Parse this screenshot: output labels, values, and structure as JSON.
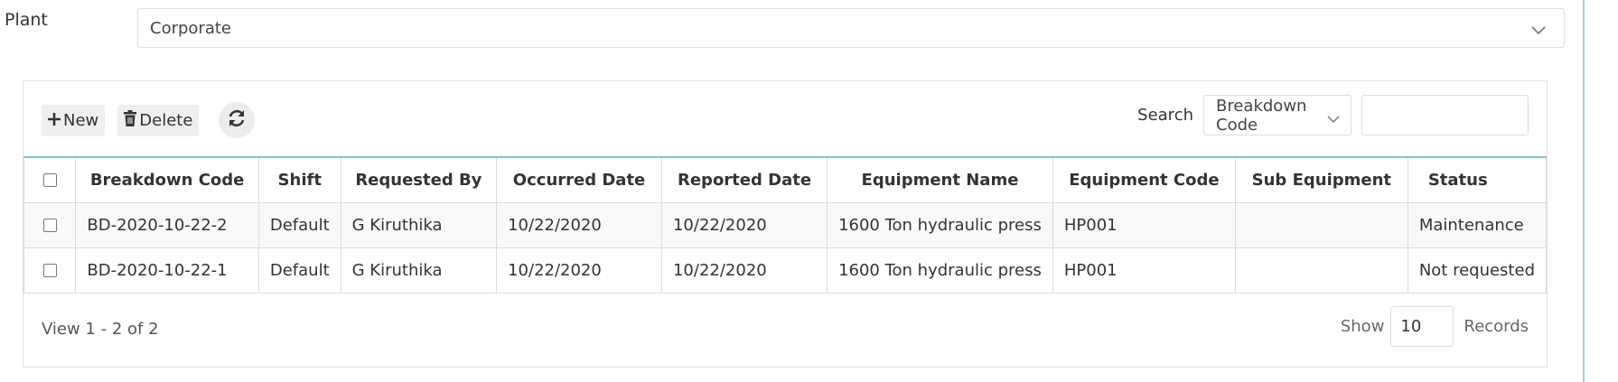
{
  "filter": {
    "plant_label": "Plant",
    "plant_value": "Corporate"
  },
  "toolbar": {
    "new_label": "New",
    "delete_label": "Delete",
    "search_label": "Search",
    "search_field": "Breakdown Code",
    "search_value": ""
  },
  "table": {
    "columns": [
      "Breakdown Code",
      "Shift",
      "Requested By",
      "Occurred Date",
      "Reported Date",
      "Equipment Name",
      "Equipment Code",
      "Sub Equipment",
      "Status"
    ],
    "rows": [
      {
        "breakdown_code": "BD-2020-10-22-2",
        "shift": "Default",
        "requested_by": "G Kiruthika",
        "occurred_date": "10/22/2020",
        "reported_date": "10/22/2020",
        "equipment_name": "1600 Ton hydraulic press",
        "equipment_code": "HP001",
        "sub_equipment": "",
        "status": "Maintenance"
      },
      {
        "breakdown_code": "BD-2020-10-22-1",
        "shift": "Default",
        "requested_by": "G Kiruthika",
        "occurred_date": "10/22/2020",
        "reported_date": "10/22/2020",
        "equipment_name": "1600 Ton hydraulic press",
        "equipment_code": "HP001",
        "sub_equipment": "",
        "status": "Not requested"
      }
    ]
  },
  "footer": {
    "view_text": "View 1 - 2 of 2",
    "show_label": "Show",
    "page_size": "10",
    "records_label": "Records"
  },
  "icons": {
    "new": "plus-icon",
    "delete": "trash-icon",
    "refresh": "refresh-icon",
    "dropdown": "chevron-down-icon"
  },
  "colors": {
    "link": "#3a86c8",
    "header_rule": "#7fc6c2",
    "button_bg": "#efefef"
  }
}
